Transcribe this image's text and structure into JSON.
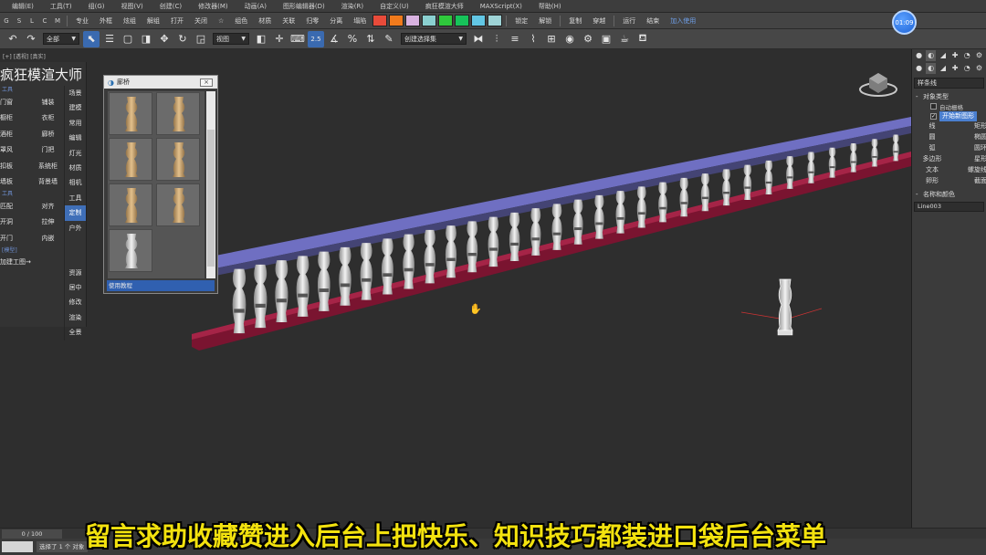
{
  "menu": [
    "编辑(E)",
    "工具(T)",
    "组(G)",
    "视图(V)",
    "创建(C)",
    "修改器(M)",
    "动画(A)",
    "图形编辑器(D)",
    "渲染(R)",
    "自定义(U)",
    "疯狂模渲大师",
    "MAXScript(X)",
    "帮助(H)"
  ],
  "toolbar1": {
    "letters": [
      "G",
      "S",
      "L",
      "C",
      "M"
    ],
    "words_a": [
      "专业",
      "外框",
      "炫组",
      "解组",
      "打开",
      "关闭"
    ],
    "star": "☆",
    "words_b": [
      "组色",
      "材质",
      "关联",
      "归零",
      "分离",
      "塌陷"
    ],
    "swatch_colors": [
      "#e84b3a",
      "#f07a1c",
      "#d8b2e0",
      "#8ad0d0",
      "#2fc93c",
      "#17c35a",
      "#62c7e5",
      "#9ed3d6"
    ],
    "words_c": [
      "锁定",
      "解锁"
    ],
    "words_d": [
      "复制",
      "穿越"
    ],
    "words_e": [
      "运行",
      "结束"
    ],
    "link": "加入使用"
  },
  "timer": "01:09",
  "toolbar2": {
    "selection_filter": "全部",
    "ref_coord": "视图",
    "named_selection": "创建选择集",
    "snap_value": "2.5"
  },
  "viewport_label": "[+] [透视] [真实]",
  "left_panel": {
    "title": "疯狂模渲大师",
    "sections": [
      {
        "heading": "工具",
        "rows": [
          [
            "门窗",
            "铺装"
          ],
          [
            "橱柜",
            "衣柜"
          ],
          [
            "酒柜",
            "廊桥"
          ],
          [
            "罩风",
            "门把"
          ],
          [
            "扣板",
            "系统柜"
          ],
          [
            "墙板",
            "背景墙"
          ]
        ]
      },
      {
        "heading": "工具",
        "rows": [
          [
            "匹配",
            "对齐"
          ],
          [
            "开洞",
            "拉伸"
          ],
          [
            "开门",
            "内嵌"
          ]
        ]
      }
    ],
    "group_label": "[模型]",
    "link": "加建工图→",
    "side": [
      "场景",
      "建模",
      "常用",
      "编辑",
      "灯光",
      "材质",
      "相机",
      "工具",
      "定制",
      "户外",
      "",
      "",
      "资源",
      "居中",
      "修改",
      "渲染",
      "全景"
    ],
    "side_active": "定制"
  },
  "dialog": {
    "title": "廊桥",
    "close": "×",
    "footer": "使用教程"
  },
  "command_panel": {
    "tabs": [
      "●",
      "◐",
      "◢",
      "✚",
      "◔",
      "⚙"
    ],
    "dropdown": "样条线",
    "rollout_object_type": "对象类型",
    "auto_grid": "自动栅格",
    "start_new_shape": "开始新图形",
    "buttons": [
      [
        "线",
        "矩形"
      ],
      [
        "圆",
        "椭圆"
      ],
      [
        "弧",
        "圆环"
      ],
      [
        "多边形",
        "星形"
      ],
      [
        "文本",
        "螺旋线"
      ],
      [
        "卵形",
        "截面"
      ]
    ],
    "rollout_name_color": "名称和颜色",
    "name_value": "Line003"
  },
  "timeslider": "0 / 100",
  "status": "选择了 1 个 对象",
  "subtitle": "留言求助收藏赞进入后台上把快乐、知识技巧都装进口袋后台菜单"
}
